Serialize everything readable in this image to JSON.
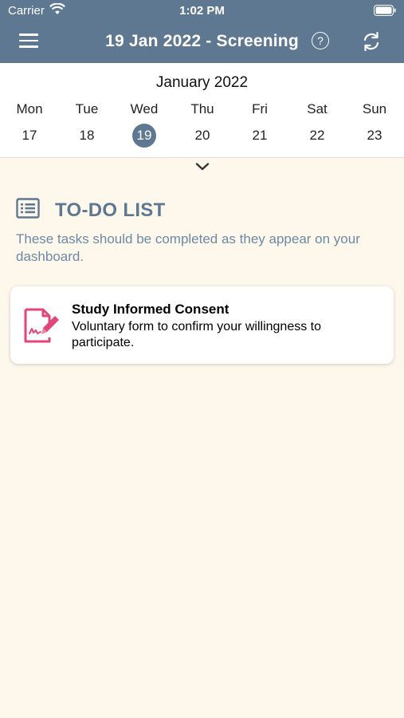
{
  "status_bar": {
    "carrier": "Carrier",
    "time": "1:02 PM"
  },
  "nav": {
    "title": "19 Jan 2022 - Screening",
    "help_label": "?",
    "menu_icon": "hamburger-icon",
    "sync_icon": "sync-icon",
    "bar_color": "#5f7891"
  },
  "calendar": {
    "month": "January 2022",
    "days": [
      {
        "dow": "Mon",
        "date": "17",
        "selected": false
      },
      {
        "dow": "Tue",
        "date": "18",
        "selected": false
      },
      {
        "dow": "Wed",
        "date": "19",
        "selected": true
      },
      {
        "dow": "Thu",
        "date": "20",
        "selected": false
      },
      {
        "dow": "Fri",
        "date": "21",
        "selected": false
      },
      {
        "dow": "Sat",
        "date": "22",
        "selected": false
      },
      {
        "dow": "Sun",
        "date": "23",
        "selected": false
      }
    ],
    "expand_icon": "chevron-down-icon"
  },
  "todo": {
    "title": "TO-DO LIST",
    "description": "These tasks should be completed as they appear on your dashboard.",
    "icon": "list-icon",
    "tasks": [
      {
        "title": "Study Informed Consent",
        "description": "Voluntary form to confirm your willingness to participate.",
        "icon": "signature-document-icon",
        "accent": "#e0457b"
      }
    ]
  }
}
